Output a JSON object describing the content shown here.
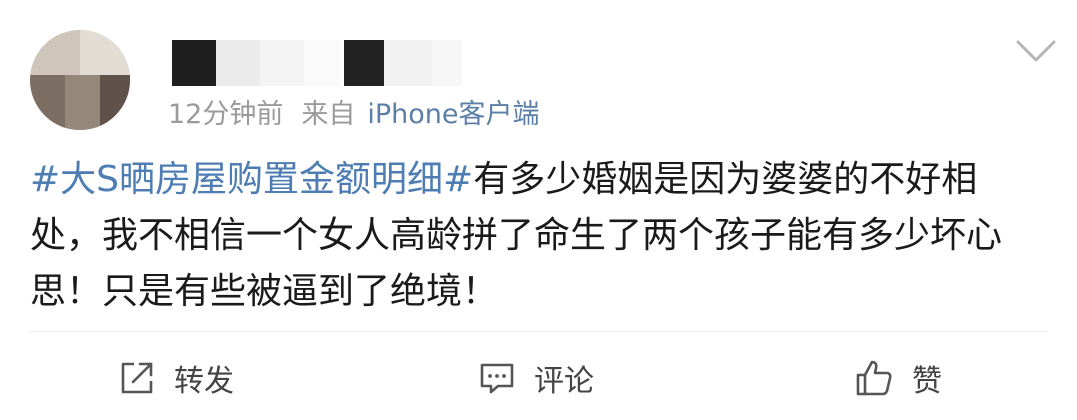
{
  "post": {
    "time": "12分钟前",
    "source_prefix": "来自",
    "source": "iPhone客户端",
    "topic": "#大S晒房屋购置金额明细#",
    "body": "有多少婚姻是因为婆婆的不好相处，我不相信一个女人高龄拼了命生了两个孩子能有多少坏心思！只是有些被逼到了绝境！"
  },
  "actions": {
    "repost_label": "转发",
    "comment_label": "评论",
    "like_label": "赞"
  },
  "icons": {
    "more": "chevron-down-icon",
    "repost": "share-icon",
    "comment": "comment-icon",
    "like": "thumbs-up-icon"
  },
  "colors": {
    "topic": "#4d7db2",
    "source": "#5b7fa6",
    "meta_text": "#9a9a9a",
    "body_text": "#1a1a1a"
  }
}
